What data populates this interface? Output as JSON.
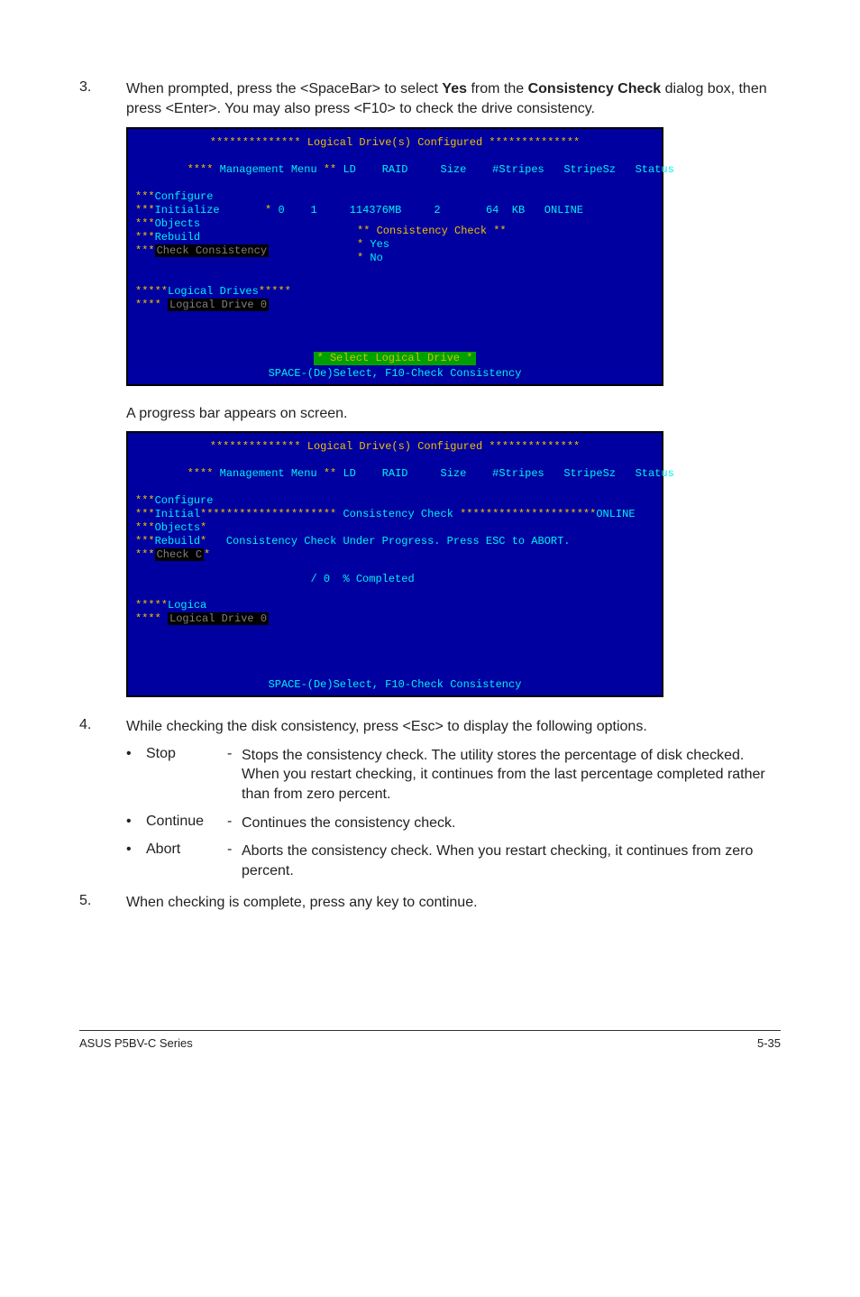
{
  "step3": {
    "num": "3.",
    "text_a": "When prompted, press the <SpaceBar> to select ",
    "bold_a": "Yes",
    "text_b": " from the ",
    "bold_b": "Consistency Check",
    "text_c": " dialog box, then press <Enter>. You may also press <F10> to check the drive consistency."
  },
  "screenshot1": {
    "title_line": "Logical Drive(s) Configured",
    "menu_title": "Management Menu",
    "headers": {
      "ld": "LD",
      "raid": "RAID",
      "size": "Size",
      "stripes": "#Stripes",
      "stripesz": "StripeSz",
      "status": "Status"
    },
    "menu": [
      "Configure",
      "Initialize",
      "Objects",
      "Rebuild",
      "Check Consistency"
    ],
    "data_row": {
      "ld": "0",
      "raid": "1",
      "size": "114376MB",
      "stripes": "2",
      "stripesz": "64  KB",
      "status": "ONLINE"
    },
    "popup_title": "Consistency Check",
    "popup_yes": "Yes",
    "popup_no": "No",
    "sub_section": "Logical Drives",
    "sub_item": "Logical Drive 0",
    "green_bar": "Select Logical Drive",
    "hint": "SPACE-(De)Select,  F10-Check Consistency"
  },
  "mid_note": "A progress bar appears on screen.",
  "screenshot2": {
    "title_line": "Logical Drive(s) Configured",
    "menu_title": "Management Menu",
    "headers": {
      "ld": "LD",
      "raid": "RAID",
      "size": "Size",
      "stripes": "#Stripes",
      "stripesz": "StripeSz",
      "status": "Status"
    },
    "menu": [
      "Configure",
      "Initial",
      "Objects",
      "Rebuild",
      "Check C"
    ],
    "right_status": "ONLINE",
    "inner_title": "Consistency Check",
    "inner_msg": "Consistency Check Under Progress. Press ESC to ABORT.",
    "progress": "/ 0  % Completed",
    "sub_section": "Logica",
    "sub_item": "Logical Drive 0",
    "hint": "SPACE-(De)Select,  F10-Check Consistency"
  },
  "step4": {
    "num": "4.",
    "text": "While checking the disk consistency, press <Esc> to display the following options."
  },
  "options": [
    {
      "bullet": "•",
      "label": "Stop",
      "dash": "-",
      "desc": "Stops the consistency check. The utility stores the percentage of disk checked. When you restart checking, it continues from the last percentage completed rather than from zero percent."
    },
    {
      "bullet": "•",
      "label": "Continue",
      "dash": "-",
      "desc": "Continues the consistency check."
    },
    {
      "bullet": "•",
      "label": "Abort",
      "dash": "-",
      "desc": "Aborts the consistency check. When you restart checking, it continues from zero percent."
    }
  ],
  "step5": {
    "num": "5.",
    "text": "When checking is complete, press any key to continue."
  },
  "footer": {
    "left": "ASUS P5BV-C Series",
    "right": "5-35"
  }
}
